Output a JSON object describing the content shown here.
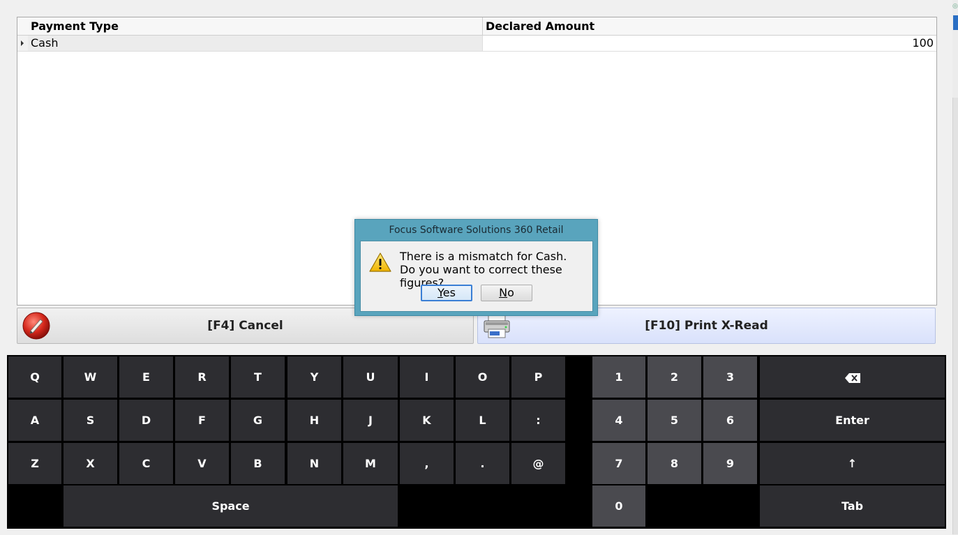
{
  "grid": {
    "columns": [
      "Payment Type",
      "Declared Amount"
    ],
    "rows": [
      {
        "payment_type": "Cash",
        "declared_amount": "100"
      }
    ]
  },
  "actions": {
    "cancel_label": "[F4] Cancel",
    "print_label": "[F10] Print X-Read"
  },
  "dialog": {
    "title": "Focus Software Solutions 360 Retail",
    "line1": "There is a mismatch for Cash.",
    "line2": "Do you want to correct these figures?",
    "yes_mnemonic": "Y",
    "yes_rest": "es",
    "no_mnemonic": "N",
    "no_rest": "o"
  },
  "keyboard": {
    "row1": [
      "Q",
      "W",
      "E",
      "R",
      "T",
      "Y",
      "U",
      "I",
      "O",
      "P"
    ],
    "row2": [
      "A",
      "S",
      "D",
      "F",
      "G",
      "H",
      "J",
      "K",
      "L",
      ":"
    ],
    "row3": [
      "Z",
      "X",
      "C",
      "V",
      "B",
      "N",
      "M",
      ",",
      ".",
      "@"
    ],
    "space": "Space",
    "numpad": [
      "1",
      "2",
      "3",
      "4",
      "5",
      "6",
      "7",
      "8",
      "9",
      "0"
    ],
    "enter": "Enter",
    "shift": "↑",
    "tab": "Tab",
    "backspace_icon": "backspace-icon"
  },
  "colors": {
    "key_letter": "#2d2d31",
    "key_number": "#4a4a4f",
    "dialog_frame": "#59a4bd"
  }
}
